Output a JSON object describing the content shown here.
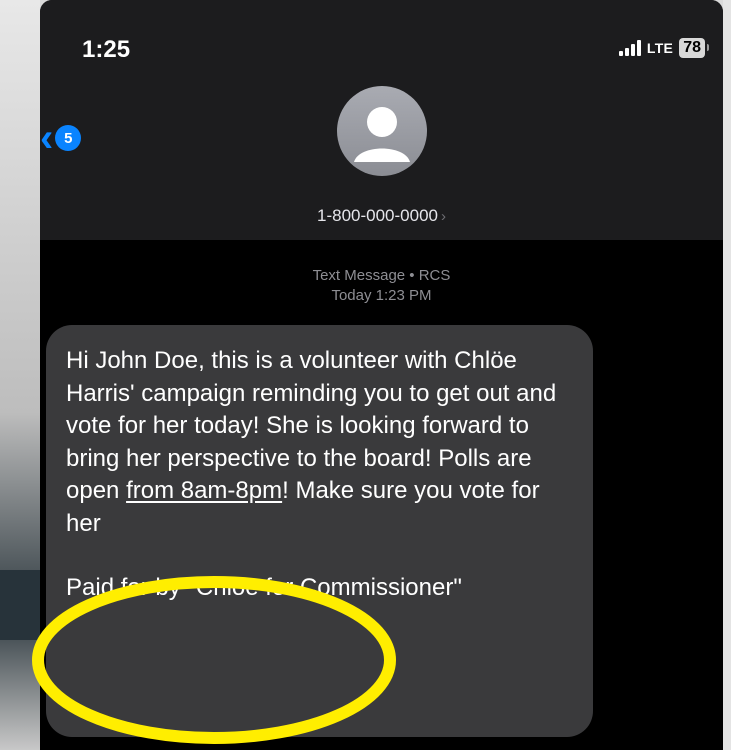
{
  "status_bar": {
    "time": "1:25",
    "network": "LTE",
    "battery": "78"
  },
  "nav": {
    "back_count": "5"
  },
  "contact": {
    "number": "1-800-000-0000",
    "chevron": "›"
  },
  "meta": {
    "service": "Text Message • RCS",
    "timestamp": "Today 1:23 PM"
  },
  "message": {
    "body_before_link": "Hi John Doe, this is a volunteer with Chlöe Harris' campaign reminding you to get out and vote for her today! She is looking forward to bring her perspective to the board! Polls are open ",
    "link_text": "from 8am-8pm",
    "body_after_link": "! Make sure you vote for her",
    "disclaimer": "Paid for by \"Chlöe for Commissioner\""
  },
  "icons": {
    "back": "chevron-left-icon",
    "avatar": "person-icon",
    "signal": "signal-icon",
    "battery": "battery-icon"
  },
  "colors": {
    "accent": "#0a84ff",
    "bubble": "#3a3a3c",
    "highlight": "#ffee00"
  }
}
